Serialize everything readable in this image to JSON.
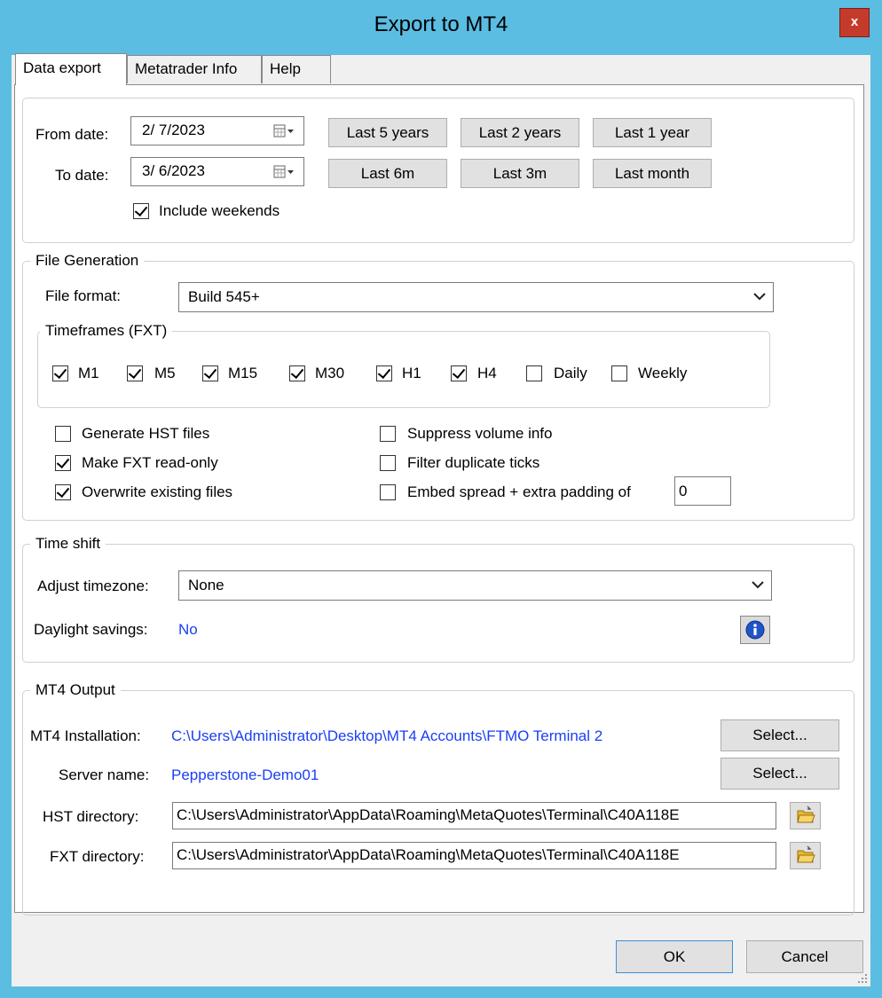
{
  "window": {
    "title": "Export to MT4",
    "close_label": "x"
  },
  "tabs": [
    {
      "label": "Data export",
      "active": true
    },
    {
      "label": "Metatrader Info",
      "active": false
    },
    {
      "label": "Help",
      "active": false
    }
  ],
  "dates": {
    "from_label": "From date:",
    "from_value": "2/  7/2023",
    "to_label": "To date:",
    "to_value": "3/  6/2023",
    "include_weekends_label": "Include weekends",
    "include_weekends": true,
    "buttons": [
      "Last 5 years",
      "Last 2 years",
      "Last 1 year",
      "Last 6m",
      "Last 3m",
      "Last month"
    ]
  },
  "file_generation": {
    "title": "File Generation",
    "file_format_label": "File format:",
    "file_format_value": "Build 545+",
    "timeframes_title": "Timeframes (FXT)",
    "timeframes": [
      {
        "label": "M1",
        "checked": true
      },
      {
        "label": "M5",
        "checked": true
      },
      {
        "label": "M15",
        "checked": true
      },
      {
        "label": "M30",
        "checked": true
      },
      {
        "label": "H1",
        "checked": true
      },
      {
        "label": "H4",
        "checked": true
      },
      {
        "label": "Daily",
        "checked": false
      },
      {
        "label": "Weekly",
        "checked": false
      }
    ],
    "options_left": [
      {
        "label": "Generate HST files",
        "checked": false
      },
      {
        "label": "Make FXT read-only",
        "checked": true
      },
      {
        "label": "Overwrite existing files",
        "checked": true
      }
    ],
    "options_right": [
      {
        "label": "Suppress volume info",
        "checked": false
      },
      {
        "label": "Filter duplicate ticks",
        "checked": false
      },
      {
        "label": "Embed spread + extra padding of",
        "checked": false
      }
    ],
    "padding_value": "0"
  },
  "time_shift": {
    "title": "Time shift",
    "adjust_label": "Adjust timezone:",
    "adjust_value": "None",
    "dst_label": "Daylight savings:",
    "dst_value": "No"
  },
  "mt4_output": {
    "title": "MT4 Output",
    "install_label": "MT4 Installation:",
    "install_value": "C:\\Users\\Administrator\\Desktop\\MT4 Accounts\\FTMO Terminal 2",
    "server_label": "Server name:",
    "server_value": "Pepperstone-Demo01",
    "select_label": "Select...",
    "hst_label": "HST directory:",
    "hst_value": "C:\\Users\\Administrator\\AppData\\Roaming\\MetaQuotes\\Terminal\\C40A118E",
    "fxt_label": "FXT directory:",
    "fxt_value": "C:\\Users\\Administrator\\AppData\\Roaming\\MetaQuotes\\Terminal\\C40A118E"
  },
  "footer": {
    "ok_label": "OK",
    "cancel_label": "Cancel"
  },
  "colors": {
    "frame": "#5bbde2",
    "link": "#1a3ff5",
    "close": "#c43b2c"
  }
}
